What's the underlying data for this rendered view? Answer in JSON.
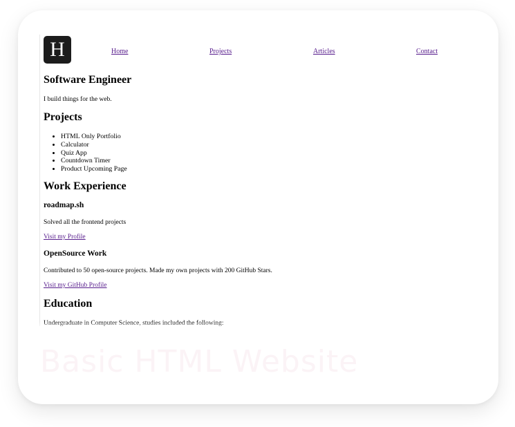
{
  "logo": {
    "letter": "H"
  },
  "nav": {
    "home": "Home",
    "projects": "Projects",
    "articles": "Articles",
    "contact": "Contact"
  },
  "hero": {
    "title": "Software Engineer",
    "tagline": "I build things for the web."
  },
  "projects": {
    "heading": "Projects",
    "items": [
      "HTML Only Portfolio",
      "Calculator",
      "Quiz App",
      "Countdown Timer",
      "Product Upcoming Page"
    ]
  },
  "work": {
    "heading": "Work Experience",
    "jobs": [
      {
        "title": "roadmap.sh",
        "description": "Solved all the frontend projects",
        "link": "Visit my Profile"
      },
      {
        "title": "OpenSource Work",
        "description": "Contributed to 50 open-source projects. Made my own projects with 200 GitHub Stars.",
        "link": "Visit my GitHub Profile"
      }
    ]
  },
  "education": {
    "heading": "Education",
    "text": "Undergraduate in Computer Science, studies included the following:"
  },
  "watermark": "Basic HTML Website"
}
